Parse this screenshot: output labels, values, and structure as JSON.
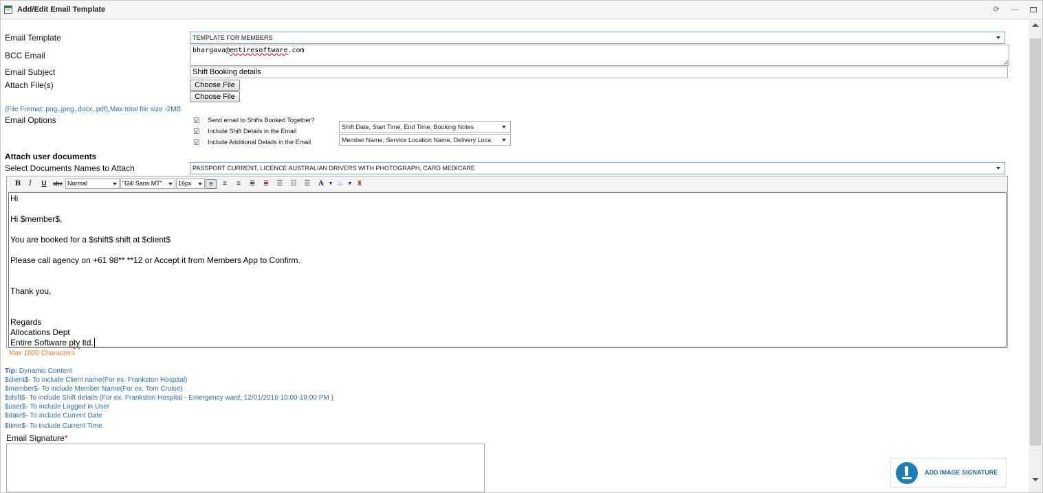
{
  "window": {
    "title": "Add/Edit Email Template"
  },
  "form": {
    "email_template": {
      "label": "Email Template",
      "value": "TEMPLATE FOR MEMBERS"
    },
    "bcc_email": {
      "label": "BCC Email",
      "value_prefix": "bhargava@",
      "value_spell": "entiresoftware",
      "value_suffix": ".com"
    },
    "email_subject": {
      "label": "Email Subject",
      "value": "Shift Booking details"
    },
    "attach_files": {
      "label": "Attach File(s)",
      "button1": "Choose File",
      "button2": "Choose File",
      "format_note": "(File Format:.png,.jpeg,.docx,.pdf),Max total file size -2MB"
    },
    "email_options": {
      "label": "Email Options",
      "options": [
        {
          "label": "Send email to Shifts Booked Together?",
          "checked": true
        },
        {
          "label": "Include Shift Details in the Email",
          "checked": true,
          "select": "Shift Date, Start Time, End Time, Booking Notes"
        },
        {
          "label": "Include Additional Details in the Email",
          "checked": true,
          "select": "Member Name, Service Location Name, Delivery Loca"
        }
      ]
    },
    "attach_user_documents": {
      "heading": "Attach user documents",
      "label": "Select Documents Names to Attach",
      "value": "PASSPORT CURRENT, LICENCE AUSTRALIAN DRIVERS WITH PHOTOGRAPH, CARD MEDICARE"
    }
  },
  "editor": {
    "toolbar": {
      "bold": "B",
      "italic": "I",
      "underline": "U",
      "strike": "abc",
      "format": "Normal",
      "font": "\"Gill Sans MT\"",
      "size": "16px"
    },
    "body": {
      "line1": "Hi",
      "line2": "Hi $member$,",
      "line3": "You are booked for a $shift$ shift at $client$",
      "line4": "Please call agency on +61 98** **12  or Accept it from Members App  to Confirm.",
      "line5": "Thank you,",
      "line6": "Regards",
      "line7": "Allocations Dept",
      "line8_prefix": "Entire Software ",
      "line8_spell": "pty",
      "line8_suffix": " ltd."
    },
    "max_chars": "Max 1000 Characters"
  },
  "tips": {
    "tip_label": "Tip:",
    "tip_text": " Dynamic Content",
    "items": [
      "$client$- To include Client name(For ex. Frankston Hospital)",
      "$member$- To include Member Name(For ex. Tom Cruise)",
      "$shift$- To include Shift details (For ex. Frankston Hospital - Emergency ward, 12/01/2016 10:00-18:00 PM )",
      "$user$- To include Logged in User",
      "$date$- To include Current Date",
      "$time$- To include Current Time"
    ]
  },
  "signature": {
    "label": "Email Signature",
    "required_mark": "*",
    "add_image_button": "ADD IMAGE SIGNATURE"
  },
  "colors": {
    "link_blue": "#2d6fb5",
    "warning_orange": "#f07d2a",
    "required_red": "#dd0000",
    "brand_blue": "#1e7fb8"
  }
}
